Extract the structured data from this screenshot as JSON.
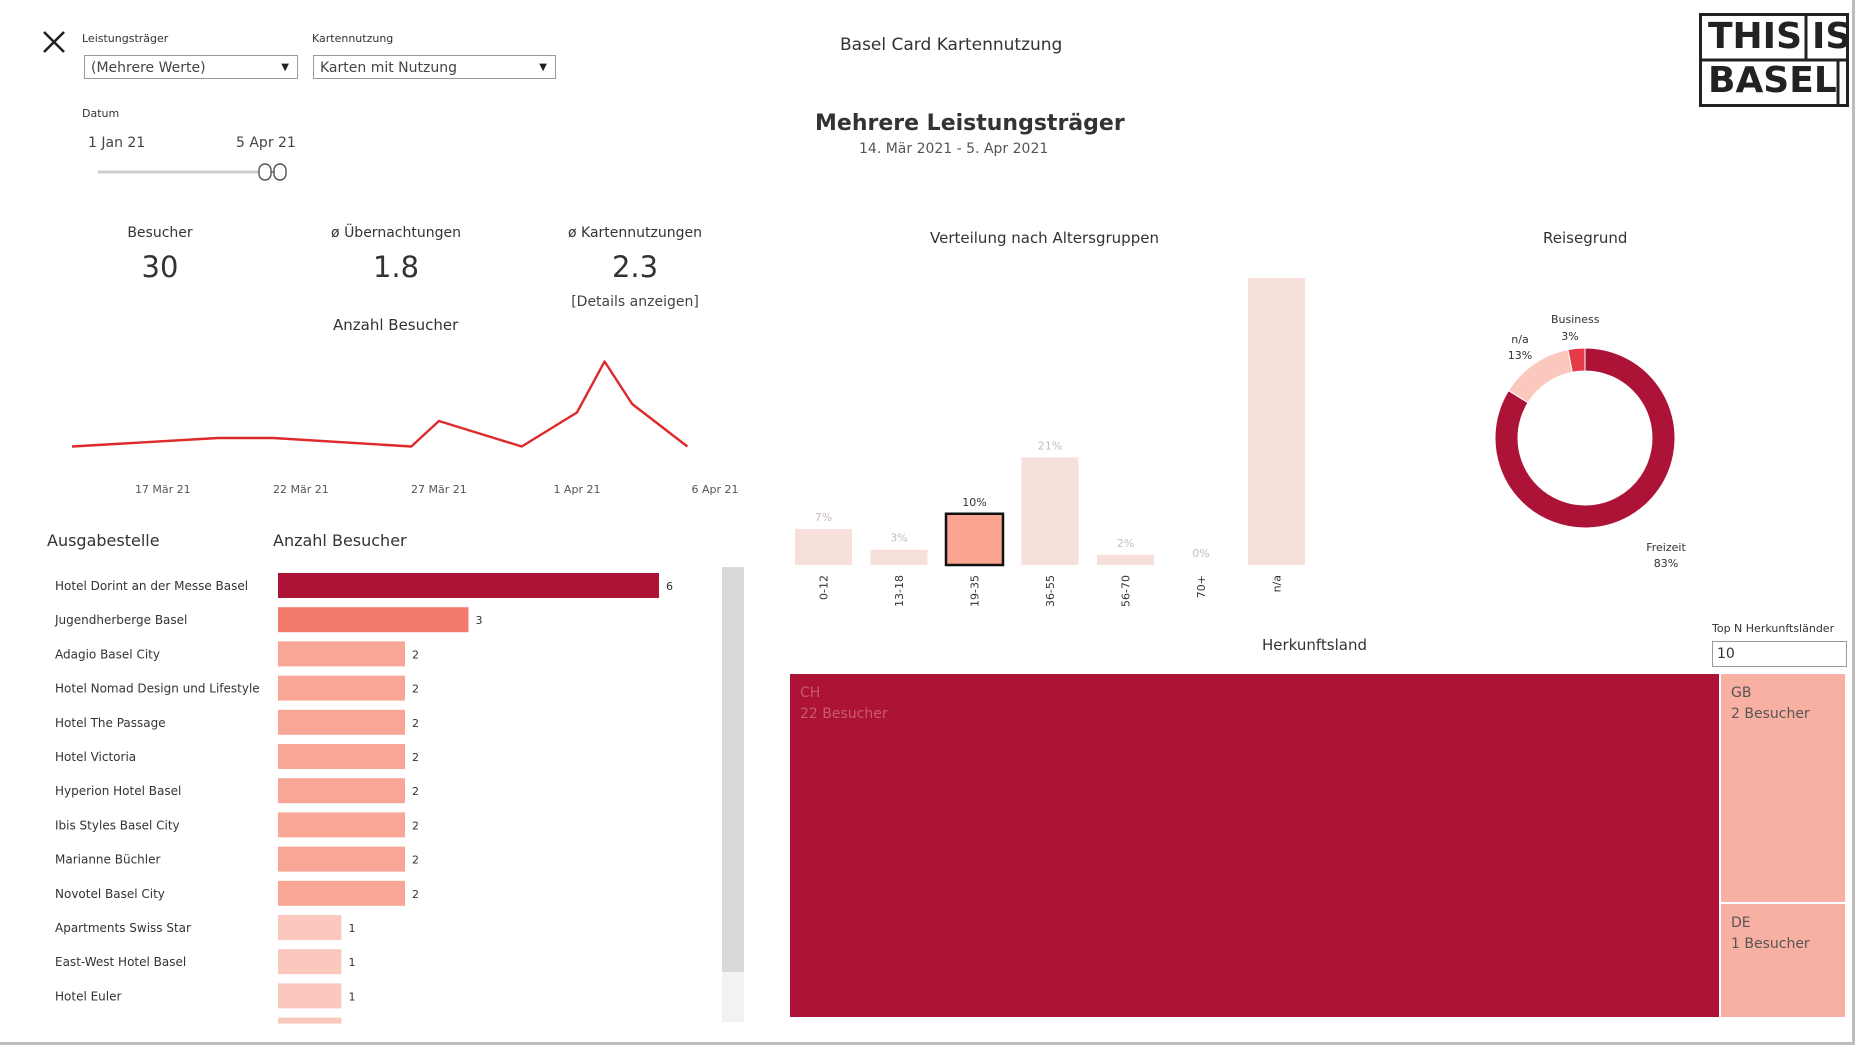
{
  "filters": {
    "leistungstraeger_label": "Leistungsträger",
    "leistungstraeger_value": "(Mehrere Werte)",
    "kartennutzung_label": "Kartennutzung",
    "kartennutzung_value": "Karten mit Nutzung",
    "datum_label": "Datum",
    "datum_start": "1 Jan 21",
    "datum_end": "5 Apr 21"
  },
  "header": {
    "title": "Basel Card Kartennutzung",
    "subtitle": "Mehrere Leistungsträger",
    "daterange": "14. Mär 2021 - 5. Apr 2021"
  },
  "logo": {
    "line1": "THIS|IS",
    "line2": "BASEL"
  },
  "kpis": {
    "besucher_label": "Besucher",
    "besucher_value": "30",
    "uebernachtungen_label": "ø Übernachtungen",
    "uebernachtungen_value": "1.8",
    "kartennutzungen_label": "ø Kartennutzungen",
    "kartennutzungen_value": "2.3",
    "details_link": "[Details anzeigen]"
  },
  "colors": {
    "dark_red": "#ad1336",
    "mid_red": "#f07b6d",
    "salmon": "#f8a796",
    "light_salmon": "#fbc8bd",
    "pale_pink": "#f7dfdc",
    "line_red": "#de2a2a",
    "selected_bar": "#f9a592"
  },
  "chart_data": [
    {
      "id": "anzahl_besucher_line",
      "type": "line",
      "title": "Anzahl Besucher",
      "x_ticks": [
        "17 Mär 21",
        "22 Mär 21",
        "27 Mär 21",
        "1 Apr 21",
        "6 Apr 21"
      ],
      "x": [
        "14 Mär 21",
        "19 Mär 21",
        "21 Mär 21",
        "26 Mär 21",
        "27 Mär 21",
        "30 Mär 21",
        "1 Apr 21",
        "2 Apr 21",
        "3 Apr 21",
        "5 Apr 21"
      ],
      "values": [
        1,
        2,
        2,
        1,
        4,
        1,
        5,
        11,
        6,
        1
      ],
      "ylim": [
        0,
        12
      ],
      "grid": false
    },
    {
      "id": "ausgabestelle_bar",
      "type": "bar",
      "orientation": "horizontal",
      "category_header": "Ausgabestelle",
      "value_header": "Anzahl Besucher",
      "categories": [
        "Hotel Dorint an der Messe Basel",
        "Jugendherberge Basel",
        "Adagio Basel City",
        "Hotel Nomad Design und Lifestyle",
        "Hotel The Passage",
        "Hotel Victoria",
        "Hyperion Hotel Basel",
        "Ibis Styles Basel City",
        "Marianne Büchler",
        "Novotel Basel City",
        "Apartments Swiss Star",
        "East-West Hotel Basel",
        "Hotel Euler"
      ],
      "values": [
        6,
        3,
        2,
        2,
        2,
        2,
        2,
        2,
        2,
        2,
        1,
        1,
        1
      ],
      "value_labels": [
        "6",
        "3",
        "2",
        "2",
        "2",
        "2",
        "2",
        "2",
        "2",
        "2",
        "1",
        "1",
        "1"
      ]
    },
    {
      "id": "altersgruppen_bar",
      "type": "bar",
      "title": "Verteilung nach Altersgruppen",
      "categories": [
        "0-12",
        "13-18",
        "19-35",
        "36-55",
        "56-70",
        "70+",
        "n/a"
      ],
      "values": [
        7,
        3,
        10,
        21,
        2,
        0,
        56
      ],
      "value_labels": [
        "7%",
        "3%",
        "10%",
        "21%",
        "2%",
        "0%",
        "56%"
      ],
      "highlighted": "19-35",
      "ylim": [
        0,
        56
      ]
    },
    {
      "id": "reisegrund_donut",
      "type": "pie",
      "title": "Reisegrund",
      "categories": [
        "Freizeit",
        "n/a",
        "Business"
      ],
      "values": [
        83,
        13,
        3
      ],
      "value_labels": [
        "83%",
        "13%",
        "3%"
      ]
    },
    {
      "id": "herkunftsland_treemap",
      "type": "treemap",
      "title": "Herkunftsland",
      "top_n_label": "Top N Herkunftsländer",
      "top_n_value": "10",
      "categories": [
        "CH",
        "GB",
        "DE"
      ],
      "values": [
        22,
        2,
        1
      ],
      "value_labels": [
        "22 Besucher",
        "2 Besucher",
        "1 Besucher"
      ]
    }
  ]
}
